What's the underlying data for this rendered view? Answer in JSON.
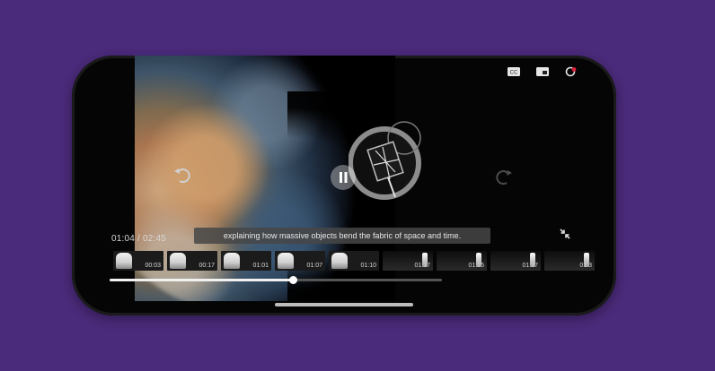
{
  "player": {
    "time_display": "01:04 / 02:45",
    "caption": "explaining how massive objects bend the fabric of space and time.",
    "progress_fraction": 0.55
  },
  "top_icons": [
    "closed-captions-icon",
    "picture-in-picture-icon",
    "settings-icon"
  ],
  "thumbnails": [
    {
      "label": "00:03",
      "style": "light"
    },
    {
      "label": "00:17",
      "style": "light"
    },
    {
      "label": "01:01",
      "style": "light"
    },
    {
      "label": "01:07",
      "style": "light"
    },
    {
      "label": "01:10",
      "style": "light"
    },
    {
      "label": "01:17",
      "style": "dark"
    },
    {
      "label": "01:25",
      "style": "dark"
    },
    {
      "label": "01:37",
      "style": "dark"
    },
    {
      "label": "01:3",
      "style": "dark"
    }
  ],
  "colors": {
    "background": "#4a2a7a",
    "phone_body": "#050505",
    "accent_red": "#e0203a"
  }
}
